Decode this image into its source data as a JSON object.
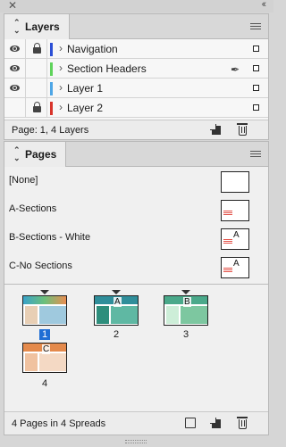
{
  "window": {
    "close_glyph": "✕",
    "collapse_glyph": "‹‹"
  },
  "layers_panel": {
    "title": "Layers",
    "rows": [
      {
        "name": "Navigation",
        "visible": true,
        "locked": true,
        "color": "#2c4fd6",
        "pen": false
      },
      {
        "name": "Section Headers",
        "visible": true,
        "locked": false,
        "color": "#5fd35b",
        "pen": true
      },
      {
        "name": "Layer 1",
        "visible": true,
        "locked": false,
        "color": "#4ea6e6",
        "pen": false
      },
      {
        "name": "Layer 2",
        "visible": false,
        "locked": true,
        "color": "#d8342b",
        "pen": false
      }
    ],
    "footer_text": "Page: 1, 4 Layers"
  },
  "pages_panel": {
    "title": "Pages",
    "masters": [
      {
        "name": "[None]",
        "letter": ""
      },
      {
        "name": "A-Sections",
        "letter": ""
      },
      {
        "name": "B-Sections - White",
        "letter": "A"
      },
      {
        "name": "C-No Sections",
        "letter": "A"
      }
    ],
    "pages": [
      {
        "number": "1",
        "master": "",
        "selected": true
      },
      {
        "number": "2",
        "master": "A",
        "selected": false
      },
      {
        "number": "3",
        "master": "B",
        "selected": false
      },
      {
        "number": "4",
        "master": "C",
        "selected": false
      }
    ],
    "footer_text": "4 Pages in 4 Spreads"
  },
  "colors": {
    "selection": "#1f6ed4",
    "panel_bg": "#f0f0f0"
  },
  "icons": [
    "close-icon",
    "collapse-icon",
    "panel-menu-icon",
    "eye-icon",
    "lock-icon",
    "pen-icon",
    "new-layer-icon",
    "trash-icon",
    "edit-page-size-icon"
  ]
}
